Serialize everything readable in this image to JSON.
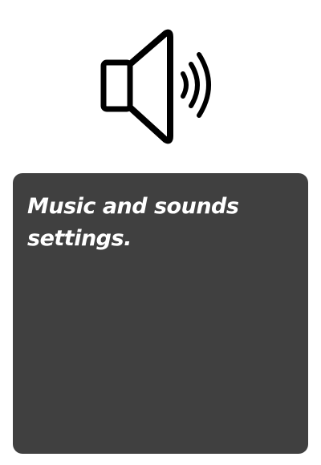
{
  "icon": {
    "name": "speaker-volume-icon"
  },
  "panel": {
    "text": "Music and sounds settings.",
    "background": "#404040",
    "text_color": "#ffffff"
  }
}
